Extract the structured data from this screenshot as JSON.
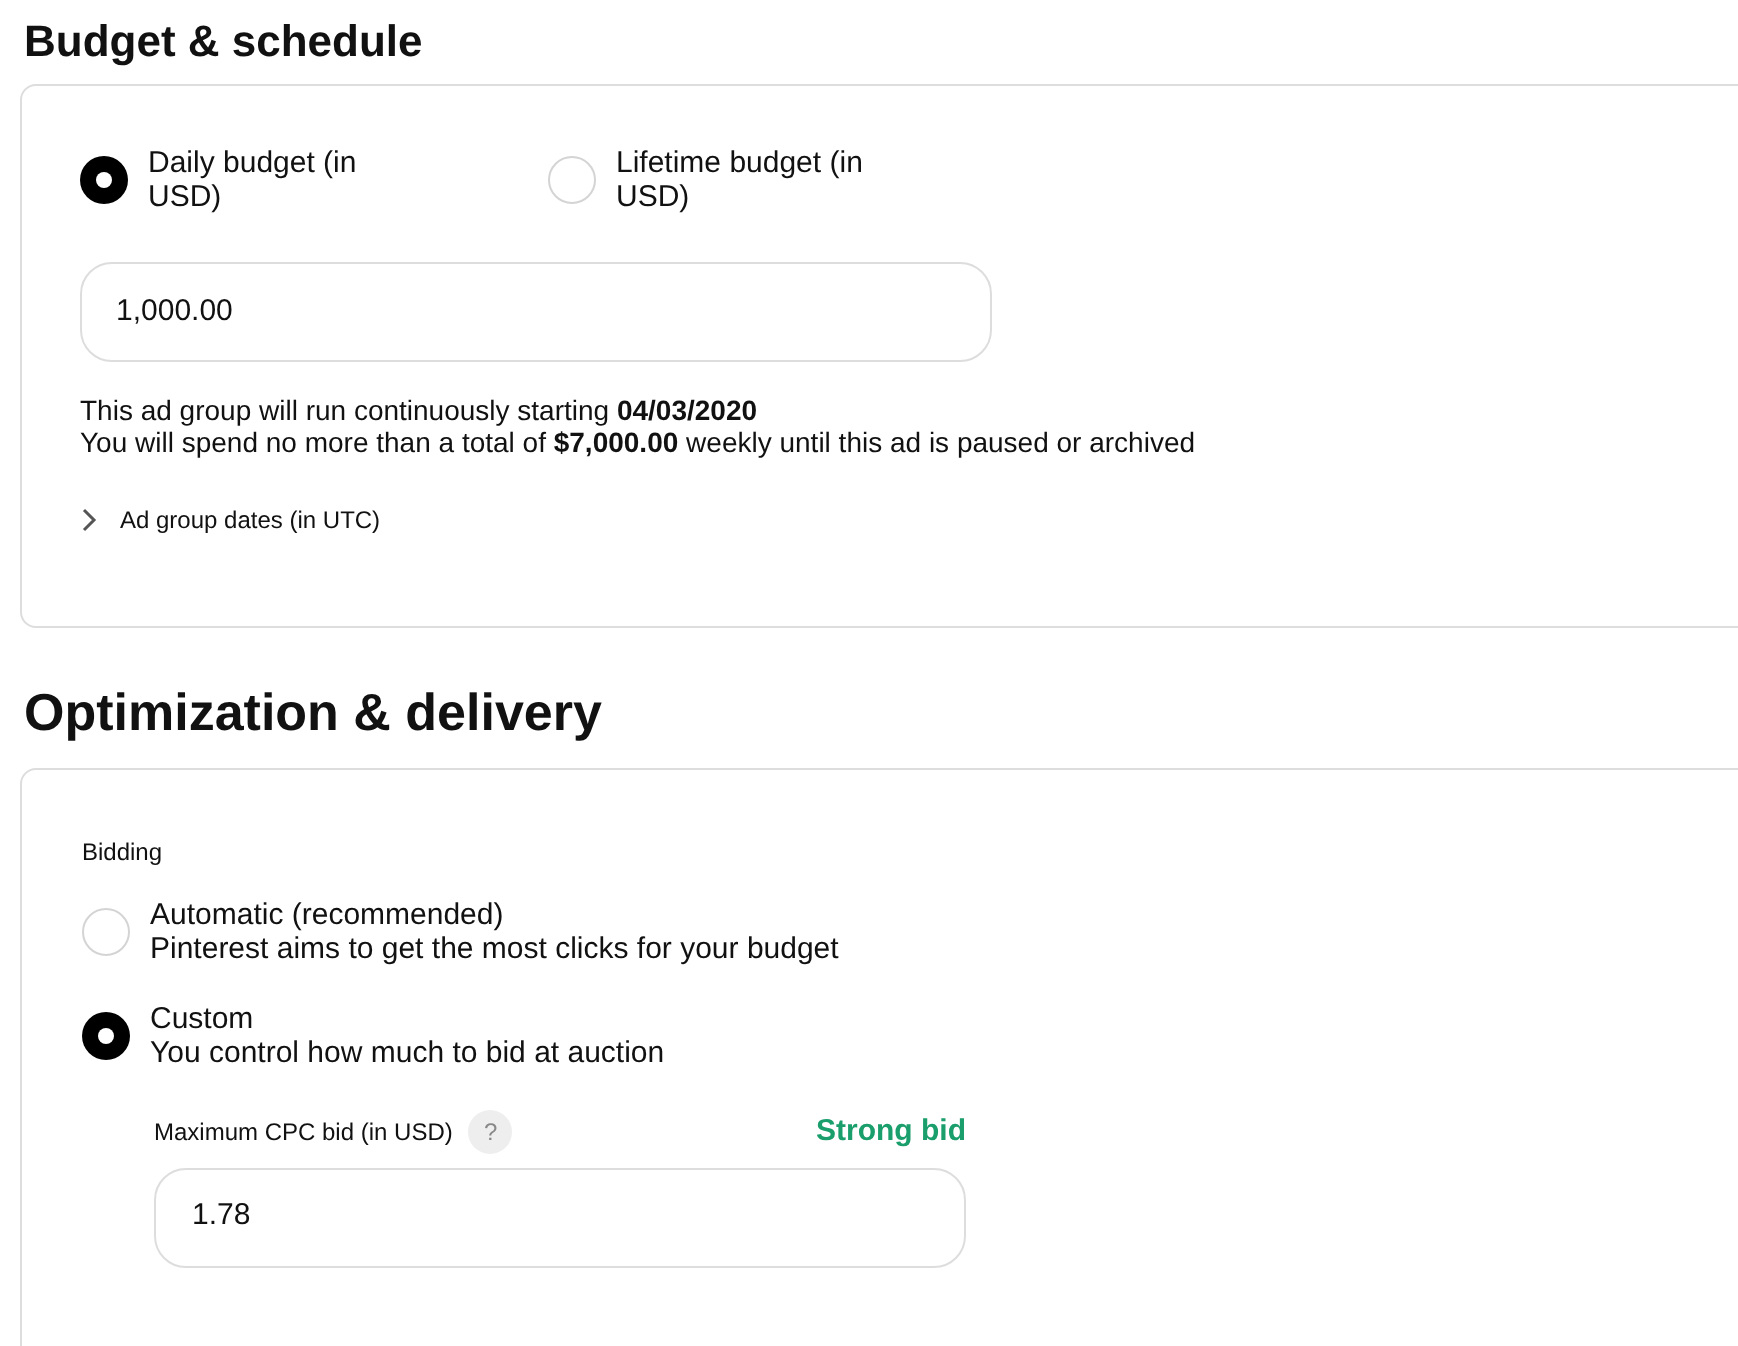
{
  "budget_section": {
    "title": "Budget & schedule",
    "budget_types": [
      {
        "label": "Daily budget (in USD)",
        "selected": true
      },
      {
        "label": "Lifetime budget (in USD)",
        "selected": false
      }
    ],
    "amount": {
      "value": "1,000.00"
    },
    "notes": [
      "This ad group will run continuously starting **04/03/2020**",
      "You will spend no more than a total of **$7,000.00** weekly until this ad is paused or archived"
    ],
    "dates_toggle": {
      "label": "Ad group dates (in UTC)",
      "expanded": false
    }
  },
  "optimization_section": {
    "title": "Optimization & delivery",
    "bidding_label": "Bidding",
    "bidding_options": [
      {
        "label": "Automatic (recommended)",
        "description": "Pinterest aims to get the most clicks for your budget",
        "selected": false
      },
      {
        "label": "Custom",
        "description": "You control how much to bid at auction",
        "selected": true
      }
    ],
    "max_bid": {
      "label": "Maximum CPC bid (in USD)",
      "help": "?",
      "strength": "Strong bid",
      "value": "1.78"
    }
  }
}
